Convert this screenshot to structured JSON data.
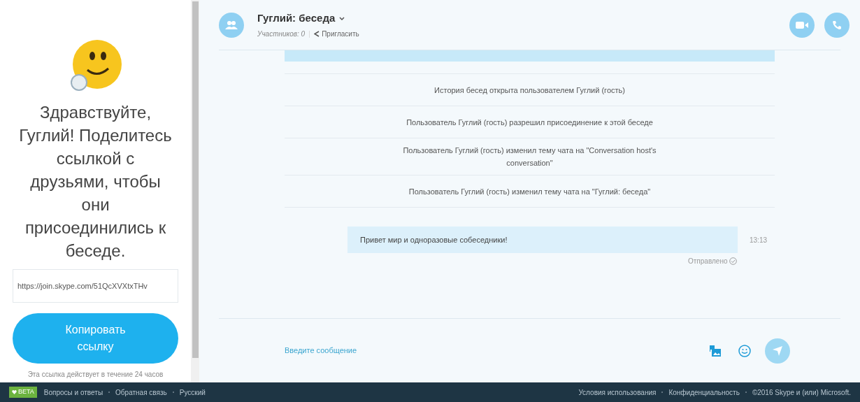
{
  "sidebar": {
    "greeting": "Здравствуйте, Гуглий! Поделитесь ссылкой с друзьями, чтобы они присоединились к беседе.",
    "link_field": {
      "value": "https://join.skype.com/51QcXVXtxTHv"
    },
    "copy_button": "Копировать ссылку",
    "note": "Эта ссылка действует в течение 24 часов"
  },
  "header": {
    "title": "Гуглий: беседа",
    "participants": "Участников: 0",
    "invite": "Пригласить"
  },
  "events": [
    {
      "text": "История бесед открыта пользователем Гуглий (гость)"
    },
    {
      "text": "Пользователь Гуглий (гость) разрешил присоединение к этой беседе"
    },
    {
      "text": "Пользователь Гуглий (гость) изменил тему чата на \"Conversation host's conversation\""
    },
    {
      "text": "Пользователь Гуглий (гость) изменил тему чата на \"Гуглий: беседа\""
    }
  ],
  "message": {
    "text": "Привет мир и одноразовые собеседники!",
    "time": "13:13",
    "status": "Отправлено"
  },
  "composer": {
    "placeholder": "Введите сообщение"
  },
  "footer": {
    "badge": "BETA",
    "left_links": [
      "Вопросы и ответы",
      "Обратная связь",
      "Русский"
    ],
    "right_links": [
      "Условия использования",
      "Конфиденциальность",
      "©2016 Skype и (или) Microsoft."
    ]
  }
}
